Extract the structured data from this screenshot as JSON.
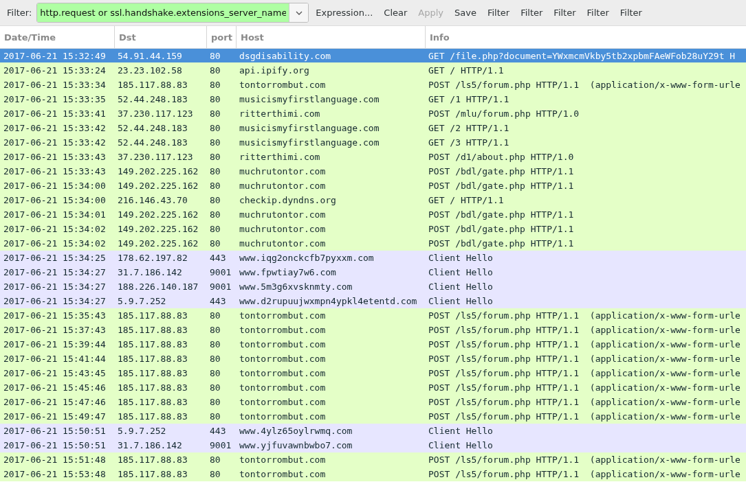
{
  "toolbar": {
    "filter_label": "Filter:",
    "filter": {
      "value": "http.request or ssl.handshake.extensions_server_name",
      "valid": true
    },
    "buttons": [
      {
        "label": "Expression...",
        "disabled": false
      },
      {
        "label": "Clear",
        "disabled": false
      },
      {
        "label": "Apply",
        "disabled": true
      },
      {
        "label": "Save",
        "disabled": false
      },
      {
        "label": "Filter",
        "disabled": false
      },
      {
        "label": "Filter",
        "disabled": false
      },
      {
        "label": "Filter",
        "disabled": false
      },
      {
        "label": "Filter",
        "disabled": false
      },
      {
        "label": "Filter",
        "disabled": false
      }
    ]
  },
  "table": {
    "columns": [
      "Date/Time",
      "Dst",
      "port",
      "Host",
      "Info"
    ],
    "rows": [
      {
        "kind": "http",
        "selected": true,
        "cells": [
          "2017-06-21 15:32:49",
          "54.91.44.159",
          "80",
          "dsgdisability.com",
          "GET /file.php?document=YWxmcmVkby5tb2xpbmFAeWFob28uY29t H"
        ]
      },
      {
        "kind": "http",
        "selected": false,
        "cells": [
          "2017-06-21 15:33:24",
          "23.23.102.58",
          "80",
          "api.ipify.org",
          "GET / HTTP/1.1"
        ]
      },
      {
        "kind": "http",
        "selected": false,
        "cells": [
          "2017-06-21 15:33:34",
          "185.117.88.83",
          "80",
          "tontorrombut.com",
          "POST /ls5/forum.php HTTP/1.1  (application/x-www-form-urle"
        ]
      },
      {
        "kind": "http",
        "selected": false,
        "cells": [
          "2017-06-21 15:33:35",
          "52.44.248.183",
          "80",
          "musicismyfirstlanguage.com",
          "GET /1 HTTP/1.1"
        ]
      },
      {
        "kind": "http",
        "selected": false,
        "cells": [
          "2017-06-21 15:33:41",
          "37.230.117.123",
          "80",
          "ritterthimi.com",
          "POST /mlu/forum.php HTTP/1.0"
        ]
      },
      {
        "kind": "http",
        "selected": false,
        "cells": [
          "2017-06-21 15:33:42",
          "52.44.248.183",
          "80",
          "musicismyfirstlanguage.com",
          "GET /2 HTTP/1.1"
        ]
      },
      {
        "kind": "http",
        "selected": false,
        "cells": [
          "2017-06-21 15:33:42",
          "52.44.248.183",
          "80",
          "musicismyfirstlanguage.com",
          "GET /3 HTTP/1.1"
        ]
      },
      {
        "kind": "http",
        "selected": false,
        "cells": [
          "2017-06-21 15:33:43",
          "37.230.117.123",
          "80",
          "ritterthimi.com",
          "POST /d1/about.php HTTP/1.0"
        ]
      },
      {
        "kind": "http",
        "selected": false,
        "cells": [
          "2017-06-21 15:33:43",
          "149.202.225.162",
          "80",
          "muchrutontor.com",
          "POST /bdl/gate.php HTTP/1.1"
        ]
      },
      {
        "kind": "http",
        "selected": false,
        "cells": [
          "2017-06-21 15:34:00",
          "149.202.225.162",
          "80",
          "muchrutontor.com",
          "POST /bdl/gate.php HTTP/1.1"
        ]
      },
      {
        "kind": "http",
        "selected": false,
        "cells": [
          "2017-06-21 15:34:00",
          "216.146.43.70",
          "80",
          "checkip.dyndns.org",
          "GET / HTTP/1.1"
        ]
      },
      {
        "kind": "http",
        "selected": false,
        "cells": [
          "2017-06-21 15:34:01",
          "149.202.225.162",
          "80",
          "muchrutontor.com",
          "POST /bdl/gate.php HTTP/1.1"
        ]
      },
      {
        "kind": "http",
        "selected": false,
        "cells": [
          "2017-06-21 15:34:02",
          "149.202.225.162",
          "80",
          "muchrutontor.com",
          "POST /bdl/gate.php HTTP/1.1"
        ]
      },
      {
        "kind": "http",
        "selected": false,
        "cells": [
          "2017-06-21 15:34:02",
          "149.202.225.162",
          "80",
          "muchrutontor.com",
          "POST /bdl/gate.php HTTP/1.1"
        ]
      },
      {
        "kind": "tls",
        "selected": false,
        "cells": [
          "2017-06-21 15:34:25",
          "178.62.197.82",
          "443",
          "www.iqg2onckcfb7pyxxm.com",
          "Client Hello"
        ]
      },
      {
        "kind": "tls",
        "selected": false,
        "cells": [
          "2017-06-21 15:34:27",
          "31.7.186.142",
          "9001",
          "www.fpwtiay7w6.com",
          "Client Hello"
        ]
      },
      {
        "kind": "tls",
        "selected": false,
        "cells": [
          "2017-06-21 15:34:27",
          "188.226.140.187",
          "9001",
          "www.5m3g6xvsknmty.com",
          "Client Hello"
        ]
      },
      {
        "kind": "tls",
        "selected": false,
        "cells": [
          "2017-06-21 15:34:27",
          "5.9.7.252",
          "443",
          "www.d2rupuujwxmpn4ypkl4etentd.com",
          "Client Hello"
        ]
      },
      {
        "kind": "http",
        "selected": false,
        "cells": [
          "2017-06-21 15:35:43",
          "185.117.88.83",
          "80",
          "tontorrombut.com",
          "POST /ls5/forum.php HTTP/1.1  (application/x-www-form-urle"
        ]
      },
      {
        "kind": "http",
        "selected": false,
        "cells": [
          "2017-06-21 15:37:43",
          "185.117.88.83",
          "80",
          "tontorrombut.com",
          "POST /ls5/forum.php HTTP/1.1  (application/x-www-form-urle"
        ]
      },
      {
        "kind": "http",
        "selected": false,
        "cells": [
          "2017-06-21 15:39:44",
          "185.117.88.83",
          "80",
          "tontorrombut.com",
          "POST /ls5/forum.php HTTP/1.1  (application/x-www-form-urle"
        ]
      },
      {
        "kind": "http",
        "selected": false,
        "cells": [
          "2017-06-21 15:41:44",
          "185.117.88.83",
          "80",
          "tontorrombut.com",
          "POST /ls5/forum.php HTTP/1.1  (application/x-www-form-urle"
        ]
      },
      {
        "kind": "http",
        "selected": false,
        "cells": [
          "2017-06-21 15:43:45",
          "185.117.88.83",
          "80",
          "tontorrombut.com",
          "POST /ls5/forum.php HTTP/1.1  (application/x-www-form-urle"
        ]
      },
      {
        "kind": "http",
        "selected": false,
        "cells": [
          "2017-06-21 15:45:46",
          "185.117.88.83",
          "80",
          "tontorrombut.com",
          "POST /ls5/forum.php HTTP/1.1  (application/x-www-form-urle"
        ]
      },
      {
        "kind": "http",
        "selected": false,
        "cells": [
          "2017-06-21 15:47:46",
          "185.117.88.83",
          "80",
          "tontorrombut.com",
          "POST /ls5/forum.php HTTP/1.1  (application/x-www-form-urle"
        ]
      },
      {
        "kind": "http",
        "selected": false,
        "cells": [
          "2017-06-21 15:49:47",
          "185.117.88.83",
          "80",
          "tontorrombut.com",
          "POST /ls5/forum.php HTTP/1.1  (application/x-www-form-urle"
        ]
      },
      {
        "kind": "tls",
        "selected": false,
        "cells": [
          "2017-06-21 15:50:51",
          "5.9.7.252",
          "443",
          "www.4ylz65oylrwmq.com",
          "Client Hello"
        ]
      },
      {
        "kind": "tls",
        "selected": false,
        "cells": [
          "2017-06-21 15:50:51",
          "31.7.186.142",
          "9001",
          "www.yjfuvawnbwbo7.com",
          "Client Hello"
        ]
      },
      {
        "kind": "http",
        "selected": false,
        "cells": [
          "2017-06-21 15:51:48",
          "185.117.88.83",
          "80",
          "tontorrombut.com",
          "POST /ls5/forum.php HTTP/1.1  (application/x-www-form-urle"
        ]
      },
      {
        "kind": "http",
        "selected": false,
        "cells": [
          "2017-06-21 15:53:48",
          "185.117.88.83",
          "80",
          "tontorrombut.com",
          "POST /ls5/forum.php HTTP/1.1  (application/x-www-form-urle"
        ]
      }
    ]
  }
}
